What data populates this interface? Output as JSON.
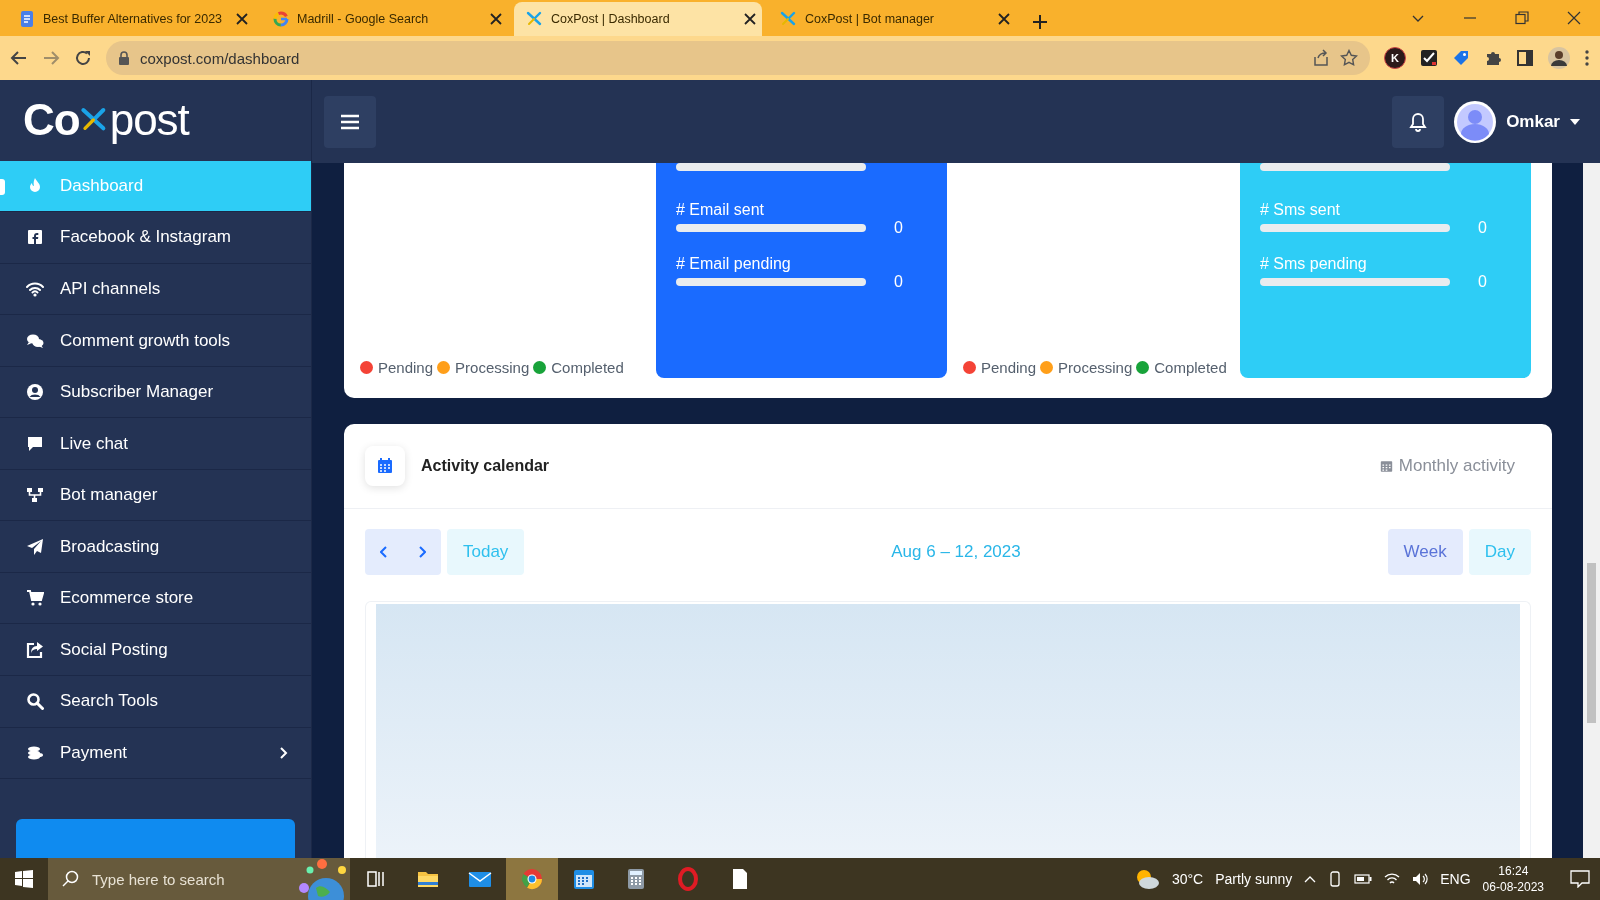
{
  "browser": {
    "tabs": [
      {
        "title": "Best Buffer Alternatives for 2023",
        "selected": false
      },
      {
        "title": "Madrill - Google Search",
        "selected": false
      },
      {
        "title": "CoxPost | Dashboard",
        "selected": true
      },
      {
        "title": "CoxPost | Bot manager",
        "selected": false
      }
    ],
    "address": "coxpost.com/dashboard",
    "extension_badge": "K"
  },
  "app": {
    "logo": {
      "left": "Co",
      "right": "post"
    },
    "user": "Omkar"
  },
  "sidebar": {
    "items": [
      {
        "label": "Dashboard",
        "selected": true,
        "kind": "link"
      },
      {
        "label": "Facebook & Instagram",
        "selected": false,
        "kind": "link"
      },
      {
        "label": "API channels",
        "selected": false,
        "kind": "link"
      },
      {
        "label": "Comment growth tools",
        "selected": false,
        "kind": "link"
      },
      {
        "label": "Subscriber Manager",
        "selected": false,
        "kind": "link"
      },
      {
        "label": "Live chat",
        "selected": false,
        "kind": "link"
      },
      {
        "label": "Bot manager",
        "selected": false,
        "kind": "link"
      },
      {
        "label": "Broadcasting",
        "selected": false,
        "kind": "link"
      },
      {
        "label": "Ecommerce store",
        "selected": false,
        "kind": "link"
      },
      {
        "label": "Social Posting",
        "selected": false,
        "kind": "link"
      },
      {
        "label": "Search Tools",
        "selected": false,
        "kind": "link"
      },
      {
        "label": "Payment",
        "selected": false,
        "kind": "submenu"
      }
    ]
  },
  "stats": [
    {
      "color": "#1a6bff",
      "legend": [
        {
          "label": "Pending",
          "color": "#f44336"
        },
        {
          "label": "Processing",
          "color": "#ff9f1a"
        },
        {
          "label": "Completed",
          "color": "#18a33a"
        }
      ],
      "rows": [
        {
          "label": "# Email sent",
          "value": "0",
          "level": 0
        },
        {
          "label": "# Email pending",
          "value": "0",
          "level": 0
        }
      ]
    },
    {
      "color": "#2ecdf6",
      "legend": [
        {
          "label": "Pending",
          "color": "#f44336"
        },
        {
          "label": "Processing",
          "color": "#ff9f1a"
        },
        {
          "label": "Completed",
          "color": "#18a33a"
        }
      ],
      "rows": [
        {
          "label": "# Sms sent",
          "value": "0",
          "level": 0
        },
        {
          "label": "# Sms pending",
          "value": "0",
          "level": 0
        }
      ]
    }
  ],
  "calendar": {
    "title": "Activity calendar",
    "link": "Monthly activity",
    "today": "Today",
    "range": "Aug 6 – 12, 2023",
    "views": [
      {
        "label": "Week",
        "selected": true
      },
      {
        "label": "Day",
        "selected": false
      }
    ]
  },
  "taskbar": {
    "search_placeholder": "Type here to search",
    "apps": [
      {
        "selected": false
      },
      {
        "selected": false
      },
      {
        "selected": false
      },
      {
        "selected": true
      },
      {
        "selected": false
      },
      {
        "selected": false
      },
      {
        "selected": false
      },
      {
        "selected": false
      }
    ],
    "temperature": "30°C",
    "weather": "Partly sunny",
    "language": "ENG",
    "time": "16:24",
    "date": "06-08-2023"
  }
}
